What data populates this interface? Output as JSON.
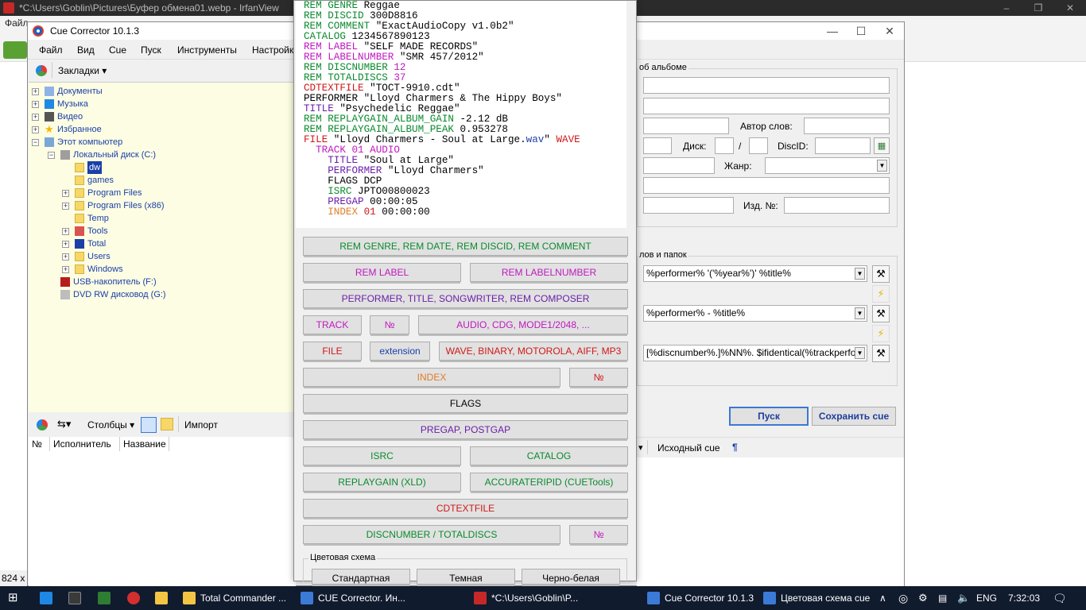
{
  "irfanview": {
    "title": "*C:\\Users\\Goblin\\Pictures\\Буфер обмена01.webp - IrfanView",
    "menu_partial": "Файл",
    "status_partial": "824 x",
    "controls": [
      "–",
      "❐",
      "✕"
    ]
  },
  "cc": {
    "title": "Cue Corrector 10.1.3",
    "controls": [
      "—",
      "☐",
      "✕"
    ],
    "menu": [
      "Файл",
      "Вид",
      "Cue",
      "Пуск",
      "Инструменты",
      "Настройк"
    ],
    "bookmarks_label": "Закладки",
    "tree": [
      {
        "label": "Документы",
        "level": 0,
        "icon": "documents-icon"
      },
      {
        "label": "Музыка",
        "level": 0,
        "icon": "music-icon"
      },
      {
        "label": "Видео",
        "level": 0,
        "icon": "video-icon"
      },
      {
        "label": "Избранное",
        "level": 0,
        "icon": "star-icon"
      },
      {
        "label": "Этот компьютер",
        "level": 0,
        "icon": "computer-icon"
      },
      {
        "label": "Локальный диск (C:)",
        "level": 1,
        "icon": "drive-icon"
      },
      {
        "label": "dw",
        "level": 2,
        "icon": "folder-icon",
        "selected": true
      },
      {
        "label": "games",
        "level": 2,
        "icon": "folder-icon"
      },
      {
        "label": "Program Files",
        "level": 2,
        "icon": "folder-icon"
      },
      {
        "label": "Program Files (x86)",
        "level": 2,
        "icon": "folder-icon"
      },
      {
        "label": "Temp",
        "level": 2,
        "icon": "folder-icon"
      },
      {
        "label": "Tools",
        "level": 2,
        "icon": "tools-folder-icon"
      },
      {
        "label": "Total",
        "level": 2,
        "icon": "floppy-icon"
      },
      {
        "label": "Users",
        "level": 2,
        "icon": "folder-icon"
      },
      {
        "label": "Windows",
        "level": 2,
        "icon": "folder-icon"
      },
      {
        "label": "USB-накопитель (F:)",
        "level": 1,
        "icon": "usb-drive-icon"
      },
      {
        "label": "DVD RW дисковод (G:)",
        "level": 1,
        "icon": "dvd-drive-icon"
      }
    ],
    "bottom_toolbar": {
      "columns_label": "Столбцы",
      "import_label": "Импорт"
    },
    "list_headers": [
      "№",
      "Исполнитель",
      "Название"
    ],
    "right": {
      "album_group": "об альбоме",
      "author_words_label": "Автор слов:",
      "disc_label": "Диск:",
      "slash": "/",
      "discid_label": "DiscID:",
      "genre_label": "Жанр:",
      "publ_label": "Изд. №:",
      "files_group": "лов и папок",
      "pattern1": "%performer% '('%year%')' %title%",
      "pattern2": "%performer% - %title%",
      "pattern3": "[%discnumber%.]%NN%. $ifidentical(%trackperfo",
      "start_btn": "Пуск",
      "save_btn": "Сохранить cue",
      "source_cue": "Исходный cue",
      "pilcrow": "¶"
    }
  },
  "popup": {
    "cue_lines": [
      [
        [
          "REM GENRE ",
          "k-rem"
        ],
        [
          "Reggae",
          "v"
        ]
      ],
      [
        [
          "REM DISCID ",
          "k-rem"
        ],
        [
          "300D8816",
          "v"
        ]
      ],
      [
        [
          "REM COMMENT ",
          "k-rem"
        ],
        [
          "\"ExactAudioCopy v1.0b2\"",
          "v"
        ]
      ],
      [
        [
          "CATALOG ",
          "k-cat"
        ],
        [
          "1234567890123",
          "v"
        ]
      ],
      [
        [
          "REM LABEL ",
          "k-mag"
        ],
        [
          "\"SELF MADE RECORDS\"",
          "v"
        ]
      ],
      [
        [
          "REM LABELNUMBER ",
          "k-mag"
        ],
        [
          "\"SMR 457/2012\"",
          "v"
        ]
      ],
      [
        [
          "REM DISCNUMBER ",
          "k-rem"
        ],
        [
          "12",
          "k-mag"
        ]
      ],
      [
        [
          "REM TOTALDISCS ",
          "k-rem"
        ],
        [
          "37",
          "k-mag"
        ]
      ],
      [
        [
          "CDTEXTFILE ",
          "k-file"
        ],
        [
          "\"TOCT-9910.cdt\"",
          "v"
        ]
      ],
      [
        [
          "PERFORMER ",
          "k-perf"
        ],
        [
          "\"Lloyd Charmers & The Hippy Boys\"",
          "v"
        ]
      ],
      [
        [
          "TITLE ",
          "k-title"
        ],
        [
          "\"Psychedelic Reggae\"",
          "v"
        ]
      ],
      [
        [
          "REM REPLAYGAIN_ALBUM_GAIN ",
          "k-rem"
        ],
        [
          "-2.12 dB",
          "v"
        ]
      ],
      [
        [
          "REM REPLAYGAIN_ALBUM_PEAK ",
          "k-rem"
        ],
        [
          "0.953278",
          "v"
        ]
      ],
      [
        [
          "FILE ",
          "k-file"
        ],
        [
          "\"Lloyd Charmers - Soul at Large.",
          "v"
        ],
        [
          "wav",
          "k-ext"
        ],
        [
          "\" ",
          "v"
        ],
        [
          "WAVE",
          "k-wave"
        ]
      ],
      [
        [
          "  TRACK ",
          "k-track"
        ],
        [
          "01 AUDIO",
          "k-track"
        ]
      ],
      [
        [
          "    TITLE ",
          "k-title"
        ],
        [
          "\"Soul at Large\"",
          "v"
        ]
      ],
      [
        [
          "    PERFORMER ",
          "k-title"
        ],
        [
          "\"Lloyd Charmers\"",
          "v"
        ]
      ],
      [
        [
          "    FLAGS ",
          "k-flags"
        ],
        [
          "DCP",
          "v"
        ]
      ],
      [
        [
          "    ISRC ",
          "k-isrc"
        ],
        [
          "JPTO00800023",
          "v"
        ]
      ],
      [
        [
          "    PREGAP ",
          "k-pregap"
        ],
        [
          "00:00:05",
          "v"
        ]
      ],
      [
        [
          "    INDEX ",
          "k-index"
        ],
        [
          "01 ",
          "k-file"
        ],
        [
          "00:00:00",
          "v"
        ]
      ]
    ],
    "buttons": {
      "rem_genre": "REM GENRE, REM DATE, REM DISCID, REM COMMENT",
      "rem_label": "REM LABEL",
      "rem_labelnumber": "REM LABELNUMBER",
      "performer": "PERFORMER, TITLE, SONGWRITER, REM COMPOSER",
      "track": "TRACK",
      "track_num": "№",
      "audio": "AUDIO, CDG, MODE1/2048, ...",
      "file": "FILE",
      "extension": "extension",
      "wave": "WAVE, BINARY, MOTOROLA, AIFF, MP3",
      "index": "INDEX",
      "index_num": "№",
      "flags": "FLAGS",
      "pregap": "PREGAP, POSTGAP",
      "isrc": "ISRC",
      "catalog": "CATALOG",
      "replaygain": "REPLAYGAIN (XLD)",
      "accuraterip": "ACCURATERIPID (CUETools)",
      "cdtextfile": "CDTEXTFILE",
      "discnumber": "DISCNUMBER / TOTALDISCS",
      "disc_num": "№"
    },
    "scheme_title": "Цветовая схема",
    "scheme_buttons": [
      "Стандартная",
      "Темная",
      "Черно-белая"
    ]
  },
  "taskbar": {
    "apps": [
      {
        "label": "Total Commander ...",
        "color": "#f4c542"
      },
      {
        "label": "CUE Corrector. Ин...",
        "color": "#3c7ad8"
      },
      {
        "label": "*C:\\Users\\Goblin\\P...",
        "color": "#c62828"
      },
      {
        "label": "Cue Corrector 10.1.3",
        "color": "#3c7ad8"
      },
      {
        "label": "Цветовая схема cue",
        "color": "#3c7ad8"
      }
    ],
    "lang": "ENG",
    "time": "7:32:03"
  },
  "colors": {
    "rem": "#0a8a2e",
    "magenta": "#c018c0",
    "purple": "#6a1fa8",
    "red": "#d01818",
    "orange": "#e07d28",
    "blue": "#1a3fa8"
  }
}
